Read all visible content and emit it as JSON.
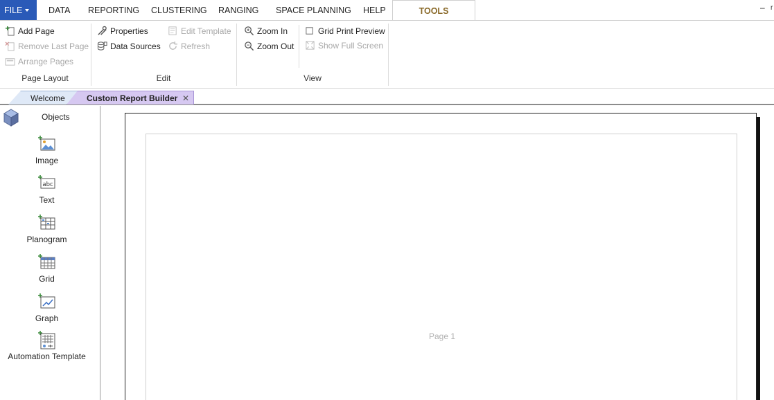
{
  "menu": {
    "file": "FILE",
    "tabs": [
      "DATA",
      "REPORTING",
      "CLUSTERING",
      "RANGING",
      "SPACE PLANNING",
      "HELP"
    ],
    "active_tab": "TOOLS",
    "minimize": "–",
    "extra": "r"
  },
  "ribbon": {
    "page_layout": {
      "label": "Page Layout",
      "add_page": "Add Page",
      "remove_last_page": "Remove Last Page",
      "arrange_pages": "Arrange Pages"
    },
    "edit": {
      "label": "Edit",
      "properties": "Properties",
      "data_sources": "Data Sources",
      "edit_template": "Edit Template",
      "refresh": "Refresh"
    },
    "view": {
      "label": "View",
      "zoom_in": "Zoom In",
      "zoom_out": "Zoom Out",
      "grid_print_preview": "Grid Print Preview",
      "show_full_screen": "Show Full Screen"
    }
  },
  "doc_tabs": {
    "welcome": "Welcome",
    "custom_report_builder": "Custom Report Builder",
    "close": "✕"
  },
  "objects": {
    "title": "Objects",
    "items": [
      "Image",
      "Text",
      "Planogram",
      "Grid",
      "Graph",
      "Automation Template"
    ]
  },
  "canvas": {
    "page_label": "Page 1"
  },
  "colors": {
    "file_bg": "#2a5ab8",
    "tools_text": "#8a6a2a",
    "active_doc_tab": "#d6c8f1",
    "welcome_tab": "#dfe9f7"
  }
}
